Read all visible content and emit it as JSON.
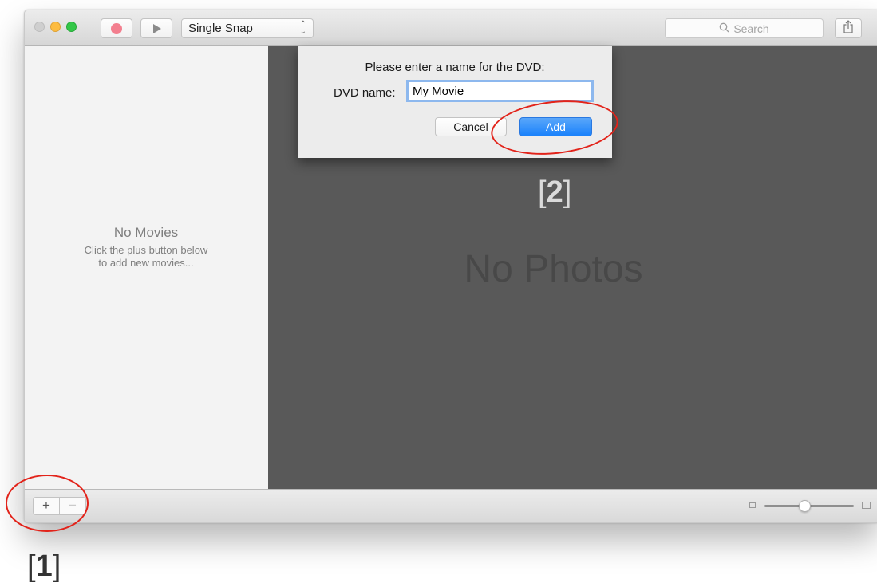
{
  "toolbar": {
    "mode_select": "Single Snap",
    "search_placeholder": "Search"
  },
  "sidebar": {
    "empty_title": "No Movies",
    "empty_line1": "Click the plus button below",
    "empty_line2": "to add new movies..."
  },
  "main": {
    "empty_text": "No Photos"
  },
  "dialog": {
    "prompt": "Please enter a name for the DVD:",
    "field_label": "DVD name:",
    "field_value": "My Movie",
    "cancel_label": "Cancel",
    "add_label": "Add"
  },
  "bottom": {
    "add_symbol": "+",
    "remove_symbol": "−",
    "zoom_level": 0.45
  },
  "annotations": {
    "step1": "1",
    "step2": "2"
  },
  "colors": {
    "accent": "#1a82fb",
    "annotation_ring": "#e2231a",
    "main_background": "#595959"
  }
}
